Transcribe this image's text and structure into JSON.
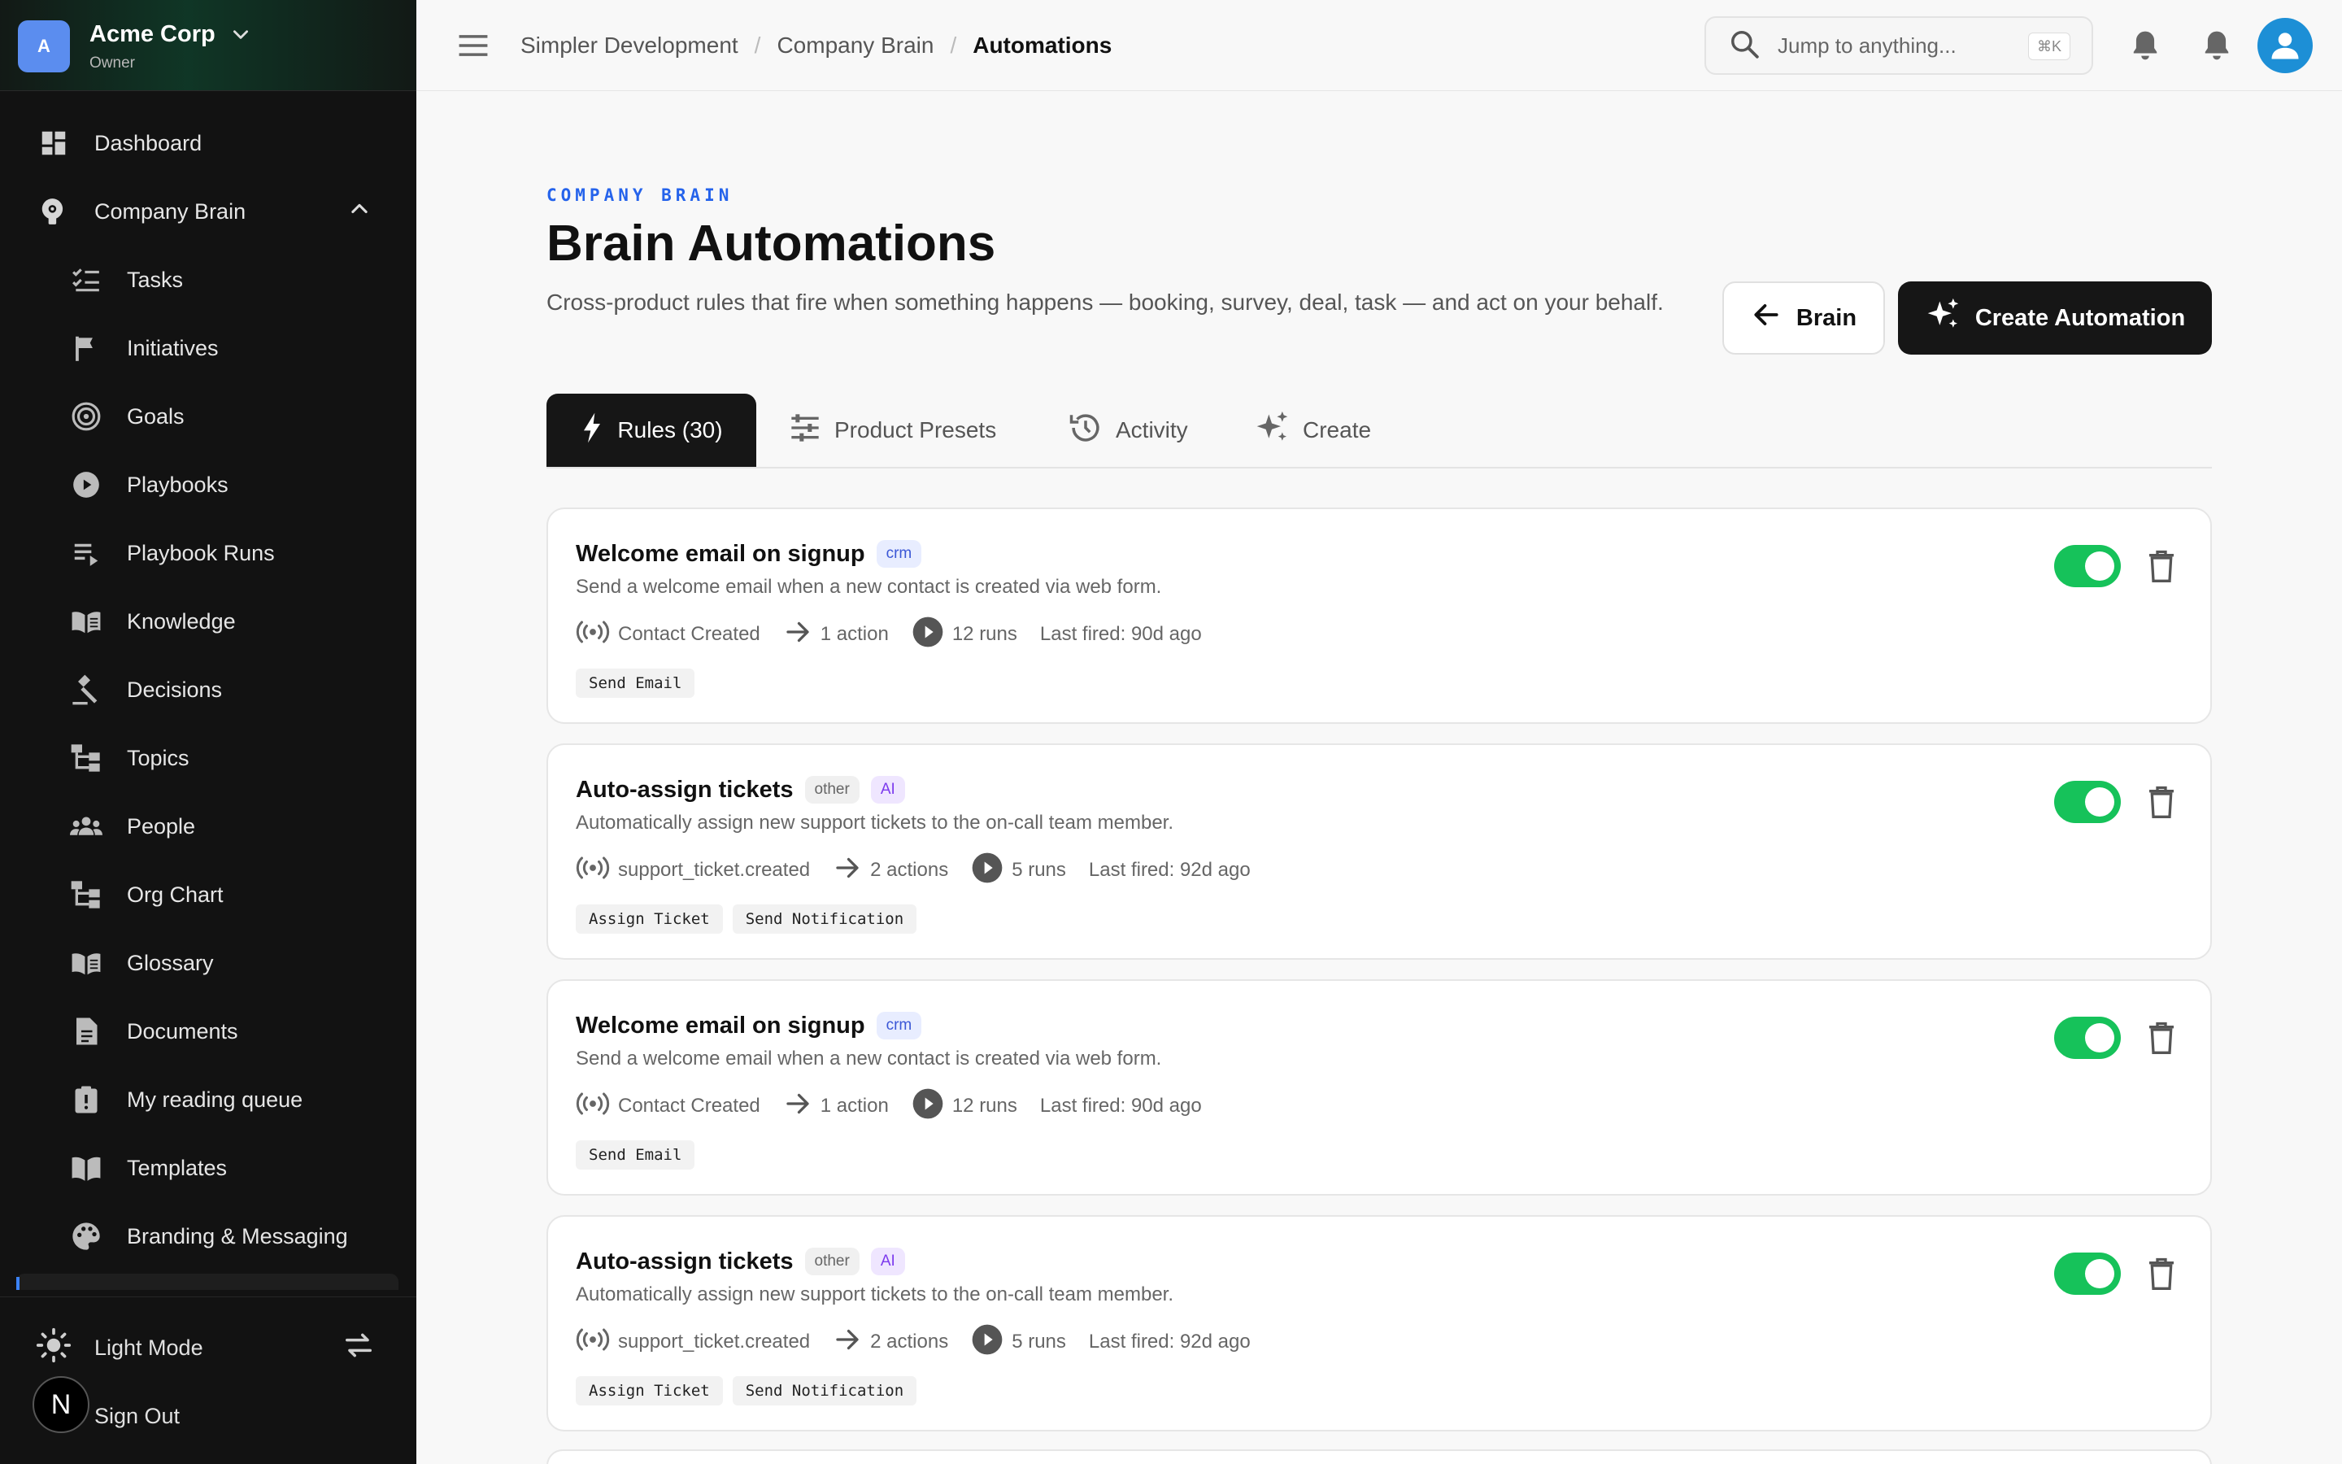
{
  "org": {
    "avatar_letter": "A",
    "name": "Acme Corp",
    "role": "Owner"
  },
  "sidebar": {
    "items": [
      {
        "label": "Dashboard",
        "icon": "dashboard-icon"
      },
      {
        "label": "Company Brain",
        "icon": "brain-icon"
      },
      {
        "label": "Tasks",
        "icon": "tasks-icon"
      },
      {
        "label": "Initiatives",
        "icon": "flag-icon"
      },
      {
        "label": "Goals",
        "icon": "target-icon"
      },
      {
        "label": "Playbooks",
        "icon": "play-circle-icon"
      },
      {
        "label": "Playbook Runs",
        "icon": "playlist-play-icon"
      },
      {
        "label": "Knowledge",
        "icon": "book-icon"
      },
      {
        "label": "Decisions",
        "icon": "gavel-icon"
      },
      {
        "label": "Topics",
        "icon": "hierarchy-icon"
      },
      {
        "label": "People",
        "icon": "people-icon"
      },
      {
        "label": "Org Chart",
        "icon": "org-chart-icon"
      },
      {
        "label": "Glossary",
        "icon": "book-icon"
      },
      {
        "label": "Documents",
        "icon": "document-icon"
      },
      {
        "label": "My reading queue",
        "icon": "clipboard-alert-icon"
      },
      {
        "label": "Templates",
        "icon": "open-book-icon"
      },
      {
        "label": "Branding & Messaging",
        "icon": "palette-icon"
      }
    ],
    "bottom": {
      "light_mode": "Light Mode",
      "sign_out": "Sign Out"
    }
  },
  "next_badge": "N",
  "header": {
    "breadcrumbs": [
      "Simpler Development",
      "Company Brain",
      "Automations"
    ],
    "search_placeholder": "Jump to anything...",
    "search_shortcut": "⌘K"
  },
  "page": {
    "eyebrow": "COMPANY BRAIN",
    "title": "Brain Automations",
    "description": "Cross-product rules that fire when something happens — booking, survey, deal, task — and act on your behalf.",
    "back_label": "Brain",
    "create_label": "Create Automation"
  },
  "tabs": [
    {
      "label": "Rules (30)",
      "icon": "bolt-icon"
    },
    {
      "label": "Product Presets",
      "icon": "sliders-icon"
    },
    {
      "label": "Activity",
      "icon": "history-icon"
    },
    {
      "label": "Create",
      "icon": "sparkles-icon"
    }
  ],
  "rules": [
    {
      "name": "Welcome email on signup",
      "badges": [
        "crm"
      ],
      "description": "Send a welcome email when a new contact is created via web form.",
      "trigger": "Contact Created",
      "actions": "1 action",
      "runs": "12 runs",
      "last_fired": "Last fired: 90d ago",
      "tags": [
        "Send Email"
      ],
      "enabled": true
    },
    {
      "name": "Auto-assign tickets",
      "badges": [
        "other",
        "AI"
      ],
      "description": "Automatically assign new support tickets to the on-call team member.",
      "trigger": "support_ticket.created",
      "actions": "2 actions",
      "runs": "5 runs",
      "last_fired": "Last fired: 92d ago",
      "tags": [
        "Assign Ticket",
        "Send Notification"
      ],
      "enabled": true
    },
    {
      "name": "Welcome email on signup",
      "badges": [
        "crm"
      ],
      "description": "Send a welcome email when a new contact is created via web form.",
      "trigger": "Contact Created",
      "actions": "1 action",
      "runs": "12 runs",
      "last_fired": "Last fired: 90d ago",
      "tags": [
        "Send Email"
      ],
      "enabled": true
    },
    {
      "name": "Auto-assign tickets",
      "badges": [
        "other",
        "AI"
      ],
      "description": "Automatically assign new support tickets to the on-call team member.",
      "trigger": "support_ticket.created",
      "actions": "2 actions",
      "runs": "5 runs",
      "last_fired": "Last fired: 92d ago",
      "tags": [
        "Assign Ticket",
        "Send Notification"
      ],
      "enabled": true
    }
  ],
  "colors": {
    "accent_blue": "#2563eb",
    "toggle_on": "#16c25a",
    "primary_dark": "#161616"
  }
}
